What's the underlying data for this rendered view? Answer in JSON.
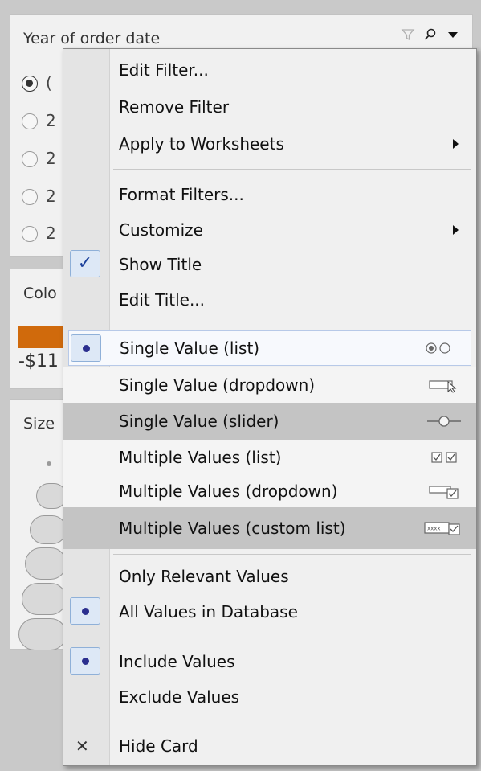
{
  "filter_card": {
    "title": "Year of order date",
    "options": [
      "(",
      "2",
      "2",
      "2",
      "2"
    ]
  },
  "color_card": {
    "title": "Colo",
    "neg_value": "-$11"
  },
  "size_card": {
    "title": "Size"
  },
  "menu": {
    "edit_filter": "Edit Filter...",
    "remove_filter": "Remove Filter",
    "apply_worksheets": "Apply to Worksheets",
    "format_filters": "Format Filters...",
    "customize": "Customize",
    "show_title": "Show Title",
    "edit_title": "Edit Title...",
    "single_list": "Single Value (list)",
    "single_dropdown": "Single Value (dropdown)",
    "single_slider": "Single Value (slider)",
    "multi_list": "Multiple Values (list)",
    "multi_dropdown": "Multiple Values (dropdown)",
    "multi_custom": "Multiple Values (custom list)",
    "only_relevant": "Only Relevant Values",
    "all_values": "All Values in Database",
    "include": "Include Values",
    "exclude": "Exclude Values",
    "hide_card": "Hide Card",
    "custom_list_icon_text": "xxxx"
  },
  "icons": {
    "filter": "funnel-icon",
    "search": "search-icon",
    "menu": "dropdown-arrow-icon",
    "check": "checkmark-icon",
    "close": "close-icon"
  },
  "colors": {
    "accent": "#2b2f8f",
    "swatch": "#d06a0c",
    "highlight_border": "#b7c9e8"
  }
}
